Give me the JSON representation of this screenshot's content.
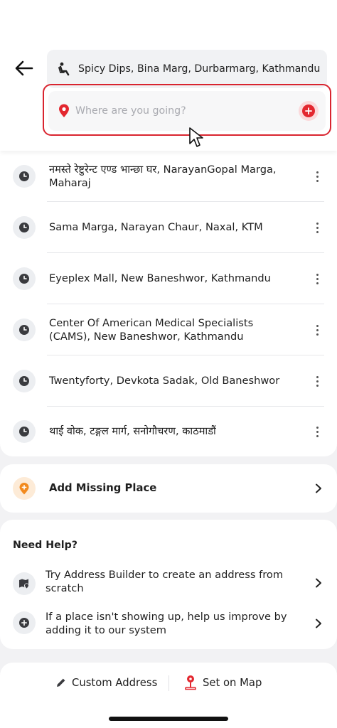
{
  "header": {
    "pickup_text": "Spicy Dips, Bina Marg, Durbarmarg, Kathmandu",
    "destination_placeholder": "Where are you going?",
    "add_stop_symbol": "+"
  },
  "recent_places": [
    {
      "text": "नमस्ते रेष्टुरेन्ट एण्ड भान्छा घर, NarayanGopal Marga, Maharaj"
    },
    {
      "text": "Sama Marga, Narayan Chaur, Naxal, KTM"
    },
    {
      "text": "Eyeplex Mall, New Baneshwor, Kathmandu"
    },
    {
      "text": "Center Of American Medical Specialists (CAMS), New Baneshwor, Kathmandu"
    },
    {
      "text": "Twentyforty, Devkota Sadak, Old Baneshwor"
    },
    {
      "text": "थाई वोक, टङ्गल मार्ग, सनोगौचरण, काठमाडौं"
    }
  ],
  "missing_place": {
    "label": "Add Missing Place"
  },
  "help": {
    "title": "Need Help?",
    "items": [
      {
        "text": "Try Address Builder to create an address from scratch"
      },
      {
        "text": "If a place isn't showing up, help us improve by adding it to our system"
      }
    ]
  },
  "bottom_bar": {
    "custom_address_label": "Custom Address",
    "set_on_map_label": "Set on Map"
  },
  "colors": {
    "accent_red": "#e3272f",
    "accent_orange": "#f28a1e"
  }
}
